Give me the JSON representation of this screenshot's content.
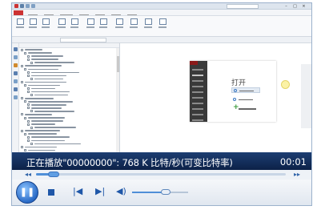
{
  "player": {
    "status_text": "正在播放\"00000000\": 768 K 比特/秒(可变比特率)",
    "time": "00:01",
    "progress_fraction": 0.06,
    "volume_fraction": 0.6,
    "icons": {
      "seek_back": "rewind-small-icon",
      "seek_forward": "forward-small-icon",
      "play_pause": "pause-icon",
      "stop": "stop-icon",
      "prev": "previous-track-icon",
      "next": "next-track-icon",
      "volume": "speaker-icon"
    },
    "glyphs": {
      "seek_back": "◂◂",
      "seek_forward": "▸▸",
      "pause": "❚❚",
      "prev": "|◀",
      "next": "▶|",
      "volume": "◀)"
    }
  },
  "video": {
    "open_title": "打开",
    "doc_tab": "",
    "accent_color": "#c33333"
  }
}
